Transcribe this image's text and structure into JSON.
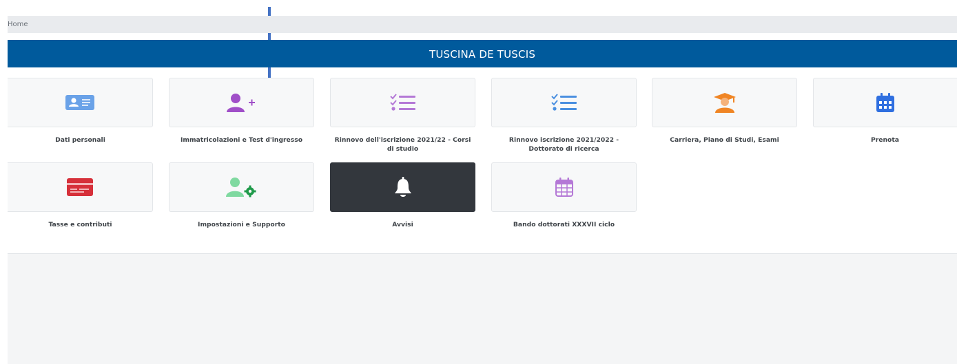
{
  "breadcrumb": {
    "home_label": "Home"
  },
  "header": {
    "title": "TUSCINA DE TUSCIS"
  },
  "tiles": [
    {
      "label": "Dati personali",
      "icon": "id-card-icon",
      "color": "#6aa2e8"
    },
    {
      "label": "Immatricolazioni e Test d'ingresso",
      "icon": "user-plus-icon",
      "color": "#a04fc8"
    },
    {
      "label": "Rinnovo dell'iscrizione 2021/22 - Corsi di studio",
      "icon": "checklist-icon",
      "color": "#b478d6"
    },
    {
      "label": "Rinnovo iscrizione 2021/2022 - Dottorato di ricerca",
      "icon": "checklist-icon",
      "color": "#4a8fe0"
    },
    {
      "label": "Carriera, Piano di Studi, Esami",
      "icon": "graduate-icon",
      "color": "#f08524"
    },
    {
      "label": "Prenota",
      "icon": "calendar-icon",
      "color": "#2f6fe0"
    },
    {
      "label": "Tasse e contributi",
      "icon": "credit-card-icon",
      "color": "#d6303a"
    },
    {
      "label": "Impostazioni e Supporto",
      "icon": "user-gear-icon",
      "color": "#5ecb86"
    },
    {
      "label": "Avvisi",
      "icon": "bell-icon",
      "color": "#ffffff"
    },
    {
      "label": "Bando dottorati XXXVII ciclo",
      "icon": "calendar-outline-icon",
      "color": "#b478d6"
    }
  ],
  "annotation": {
    "arrow_color": "#4472c4"
  }
}
